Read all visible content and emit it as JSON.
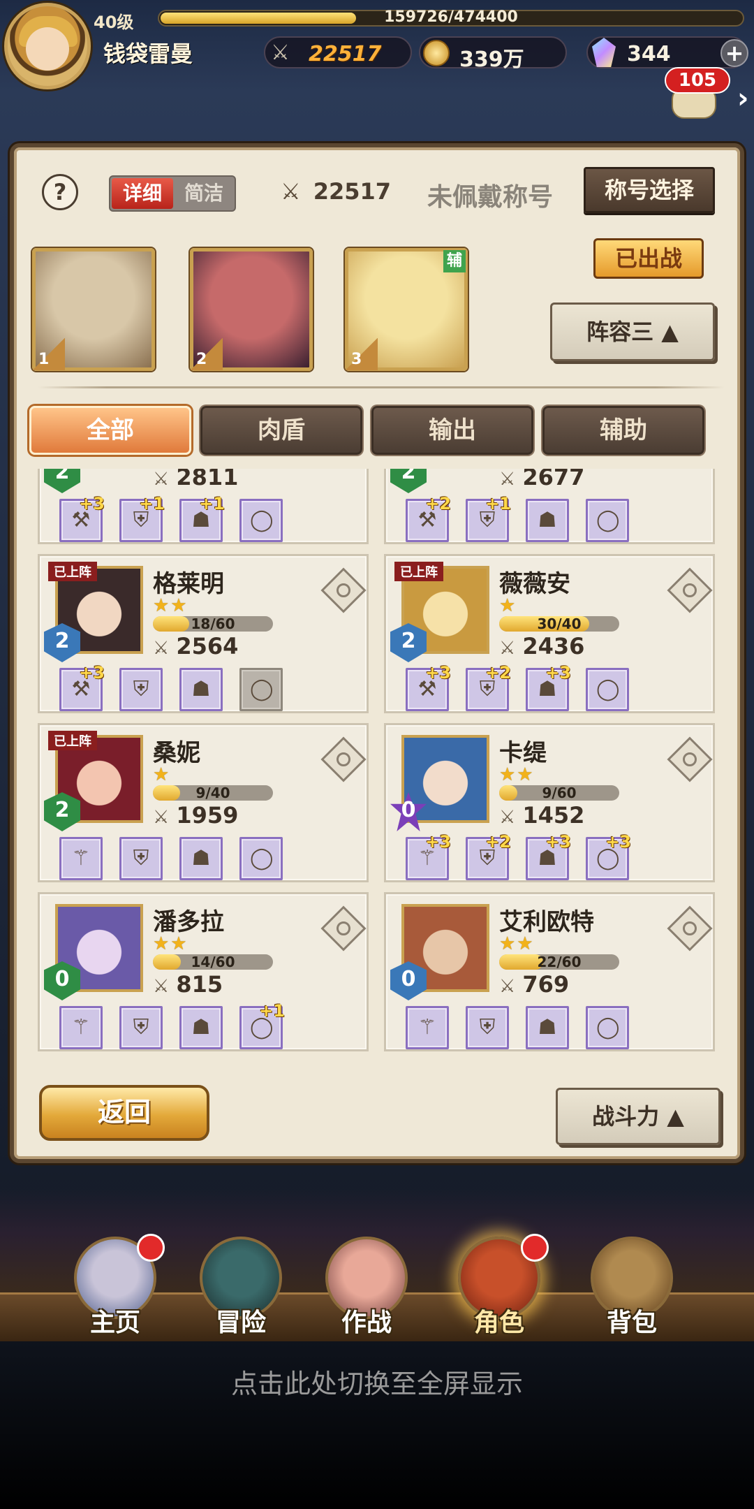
{
  "player": {
    "level": "40级",
    "xp": "159726/474400",
    "xp_fraction": 0.337,
    "name": "钱袋雷曼",
    "power": "22517",
    "gold": "339万",
    "gems": "344"
  },
  "chat": {
    "unread": "105"
  },
  "panel": {
    "help": "?",
    "view_detail": "详细",
    "view_simple": "简洁",
    "team_power": "22517",
    "title_status": "未佩戴称号",
    "title_select": "称号选择",
    "deployed_button": "已出战",
    "formation": "阵容三 ▲",
    "team_slots": [
      {
        "num": "1",
        "aux": "",
        "colors": [
          "#d8c7a8",
          "#8a7050"
        ]
      },
      {
        "num": "2",
        "aux": "",
        "colors": [
          "#c66a6a",
          "#3a2030"
        ]
      },
      {
        "num": "3",
        "aux": "辅",
        "colors": [
          "#f4e2a0",
          "#c9a050"
        ]
      }
    ],
    "filters": [
      "全部",
      "肉盾",
      "输出",
      "辅助"
    ],
    "active_filter": 0,
    "back": "返回",
    "sort": "战斗力 ▲"
  },
  "heroes_partial": [
    {
      "level": "2",
      "badge": "green",
      "power": "2811",
      "equip": [
        {
          "icon": "axe",
          "plus": "+3"
        },
        {
          "icon": "armor",
          "plus": "+1"
        },
        {
          "icon": "boots",
          "plus": "+1"
        },
        {
          "icon": "ring",
          "plus": ""
        }
      ]
    },
    {
      "level": "2",
      "badge": "green",
      "power": "2677",
      "equip": [
        {
          "icon": "axe",
          "plus": "+2"
        },
        {
          "icon": "armor",
          "plus": "+1"
        },
        {
          "icon": "boots",
          "plus": ""
        },
        {
          "icon": "ring",
          "plus": ""
        }
      ]
    }
  ],
  "heroes": [
    {
      "name": "格莱明",
      "deployed": "已上阵",
      "stars": "★★",
      "exp": "18/60",
      "exp_fraction": 0.3,
      "power": "2564",
      "level": "2",
      "badge": "blue",
      "portrait": [
        "#f1d7c2",
        "#3a2a2a"
      ],
      "equip": [
        {
          "icon": "axe",
          "plus": "+3"
        },
        {
          "icon": "armor",
          "plus": ""
        },
        {
          "icon": "boots",
          "plus": ""
        },
        {
          "icon": "ring",
          "plus": "",
          "empty": true
        }
      ]
    },
    {
      "name": "薇薇安",
      "deployed": "已上阵",
      "stars": "★",
      "exp": "30/40",
      "exp_fraction": 0.75,
      "power": "2436",
      "level": "2",
      "badge": "blue",
      "portrait": [
        "#f6e1a8",
        "#c99a40"
      ],
      "equip": [
        {
          "icon": "axe",
          "plus": "+3"
        },
        {
          "icon": "armor",
          "plus": "+2"
        },
        {
          "icon": "boots",
          "plus": "+3"
        },
        {
          "icon": "ring",
          "plus": ""
        }
      ]
    },
    {
      "name": "桑妮",
      "deployed": "已上阵",
      "stars": "★",
      "exp": "9/40",
      "exp_fraction": 0.225,
      "power": "1959",
      "level": "2",
      "badge": "green",
      "portrait": [
        "#f3c5b0",
        "#7a1e2a"
      ],
      "equip": [
        {
          "icon": "staff",
          "plus": ""
        },
        {
          "icon": "armor",
          "plus": ""
        },
        {
          "icon": "boots",
          "plus": ""
        },
        {
          "icon": "ring",
          "plus": ""
        }
      ]
    },
    {
      "name": "卡缇",
      "deployed": "",
      "stars": "★★",
      "exp": "9/60",
      "exp_fraction": 0.15,
      "power": "1452",
      "level": "0",
      "badge": "purple",
      "portrait": [
        "#f2dccb",
        "#3a6aa8"
      ],
      "equip": [
        {
          "icon": "staff",
          "plus": "+3"
        },
        {
          "icon": "armor",
          "plus": "+2"
        },
        {
          "icon": "boots",
          "plus": "+3"
        },
        {
          "icon": "ring",
          "plus": "+3"
        }
      ]
    },
    {
      "name": "潘多拉",
      "deployed": "",
      "stars": "★★",
      "exp": "14/60",
      "exp_fraction": 0.233,
      "power": "815",
      "level": "0",
      "badge": "green",
      "portrait": [
        "#e8d6f0",
        "#6a5aa8"
      ],
      "equip": [
        {
          "icon": "staff",
          "plus": ""
        },
        {
          "icon": "armor",
          "plus": ""
        },
        {
          "icon": "boots",
          "plus": ""
        },
        {
          "icon": "ring",
          "plus": "+1"
        }
      ]
    },
    {
      "name": "艾利欧特",
      "deployed": "",
      "stars": "★★",
      "exp": "22/60",
      "exp_fraction": 0.367,
      "power": "769",
      "level": "0",
      "badge": "blue",
      "portrait": [
        "#e7c6a8",
        "#a85a3a"
      ],
      "equip": [
        {
          "icon": "staff",
          "plus": ""
        },
        {
          "icon": "armor",
          "plus": ""
        },
        {
          "icon": "boots",
          "plus": ""
        },
        {
          "icon": "ring",
          "plus": ""
        }
      ]
    }
  ],
  "icons": {
    "axe": "⚒",
    "armor": "⛨",
    "boots": "☗",
    "ring": "◯",
    "staff": "⚚"
  },
  "nav": [
    {
      "label": "主页",
      "dot": true,
      "active": false,
      "colors": [
        "#c9c4d8",
        "#4a5a8a"
      ]
    },
    {
      "label": "冒险",
      "dot": false,
      "active": false,
      "colors": [
        "#3a6a6a",
        "#1a2a2a"
      ]
    },
    {
      "label": "作战",
      "dot": false,
      "active": false,
      "colors": [
        "#e8a898",
        "#6a3a3a"
      ]
    },
    {
      "label": "角色",
      "dot": true,
      "active": true,
      "colors": [
        "#c8502a",
        "#6a1e10"
      ]
    },
    {
      "label": "背包",
      "dot": false,
      "active": false,
      "colors": [
        "#b08a50",
        "#5a3a1a"
      ]
    }
  ],
  "fullscreen_hint": "点击此处切换至全屏显示"
}
